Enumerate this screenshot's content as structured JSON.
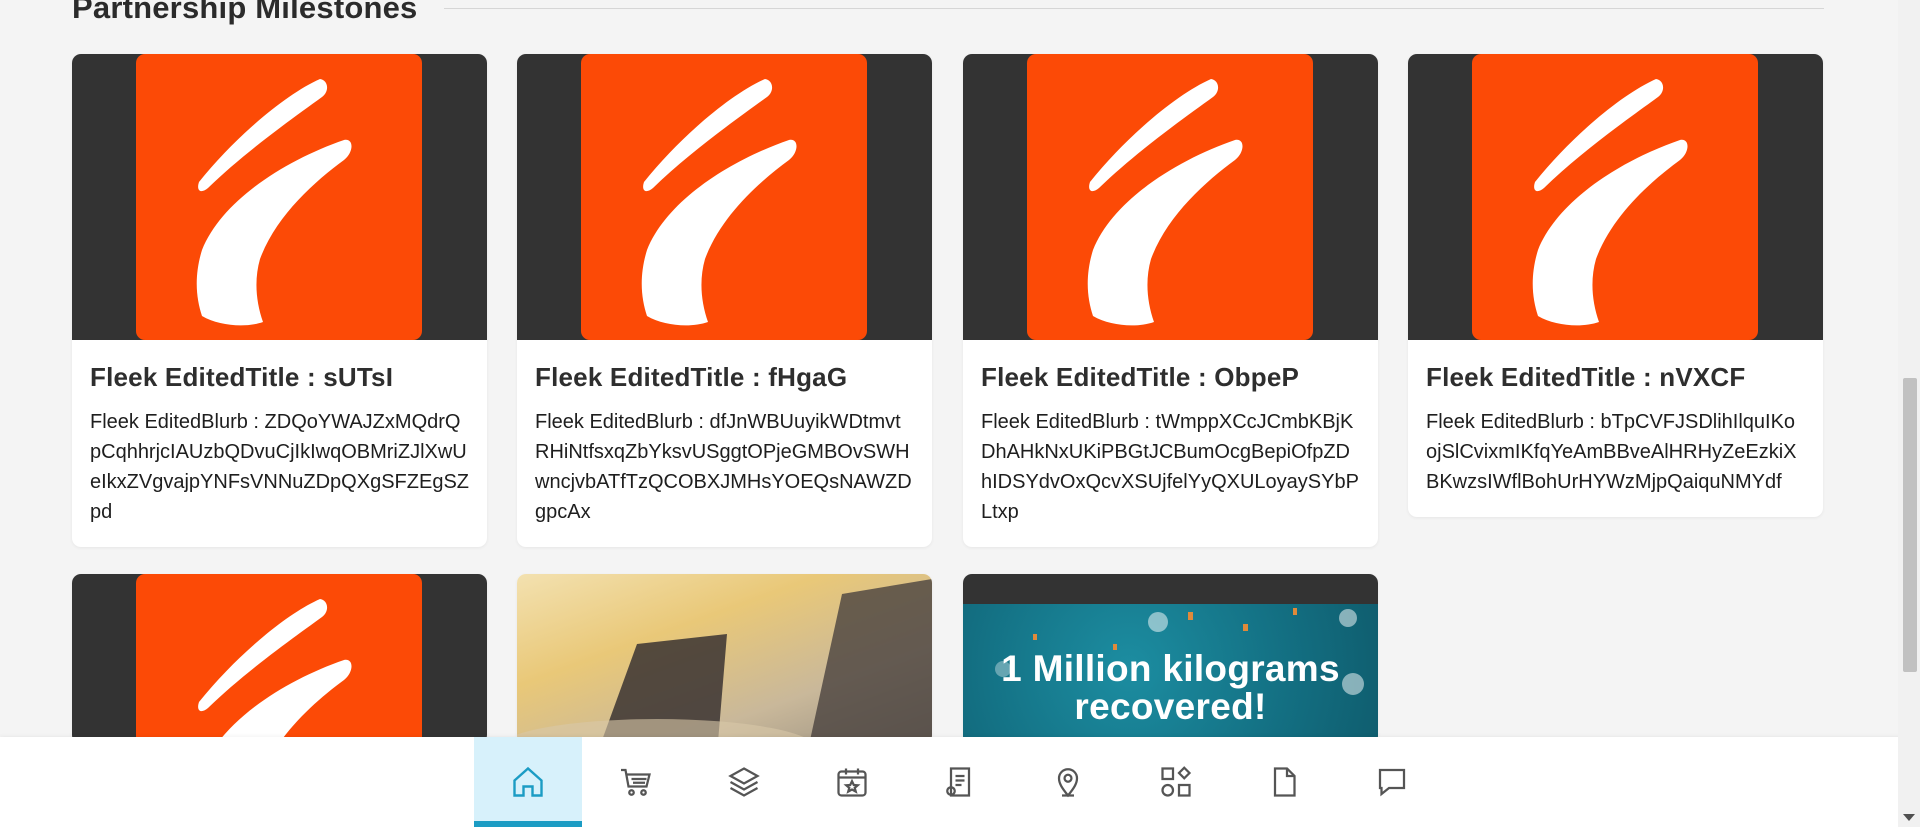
{
  "section": {
    "title": "Partnership Milestones"
  },
  "cards": [
    {
      "title": "Fleek EditedTitle : sUTsI",
      "blurb": "Fleek EditedBlurb : ZDQoYWAJZxMQdrQpCqhhrjcIAUzbQDvuCjIkIwqOBMriZJlXwUeIkxZVgvajpYNFsVNNuZDpQXgSFZEgSZpd"
    },
    {
      "title": "Fleek EditedTitle : fHgaG",
      "blurb": "Fleek EditedBlurb : dfJnWBUuyikWDtmvtRHiNtfsxqZbYksvUSggtOPjeGMBOvSWHwncjvbATfTzQCOBXJMHsYOEQsNAWZDgpcAx"
    },
    {
      "title": "Fleek EditedTitle : ObpeP",
      "blurb": "Fleek EditedBlurb : tWmppXCcJCmbKBjKDhAHkNxUKiPBGtJCBumOcgBepiOfpZDhIDSYdvOxQcvXSUjfelYyQXULoyaySYbPLtxp"
    },
    {
      "title": "Fleek EditedTitle : nVXCF",
      "blurb": "Fleek EditedBlurb : bTpCVFJSDlihIlquIKoojSlCvixmIKfqYeAmBBveAlHRHyZeEzkiXBKwzsIWflBohUrHYWzMjpQaiquNMYdf"
    }
  ],
  "banner_card": {
    "text": "1 Million kilograms recovered!"
  },
  "bottom_nav": {
    "active": "home-icon",
    "items": [
      "home-icon",
      "cart-icon",
      "layers-icon",
      "calendar-star-icon",
      "receipt-icon",
      "map-pin-icon",
      "widgets-icon",
      "document-icon",
      "chat-icon"
    ]
  },
  "colors": {
    "brand": "#fc4a06",
    "dark": "#333333",
    "nav_active_bg": "#d7f1fb",
    "nav_active_bar": "#1b9cc4"
  }
}
